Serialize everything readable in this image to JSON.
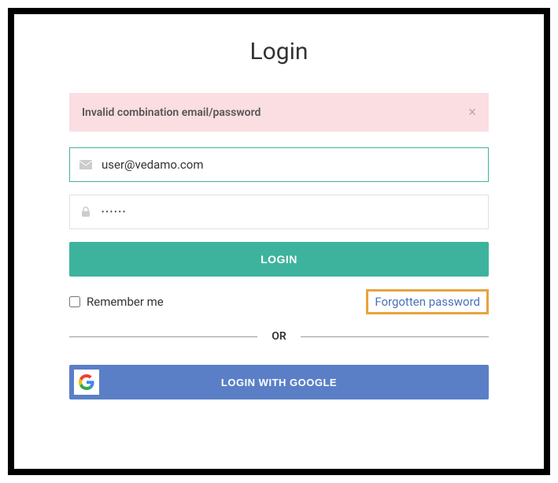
{
  "title": "Login",
  "alert": {
    "message": "Invalid combination email/password",
    "close": "×"
  },
  "email": {
    "value": "user@vedamo.com",
    "placeholder": ""
  },
  "password": {
    "value": "••••••",
    "placeholder": ""
  },
  "login_button": "LOGIN",
  "remember_label": "Remember me",
  "forgot_link": "Forgotten password",
  "divider": "OR",
  "google_button": "LOGIN WITH GOOGLE"
}
